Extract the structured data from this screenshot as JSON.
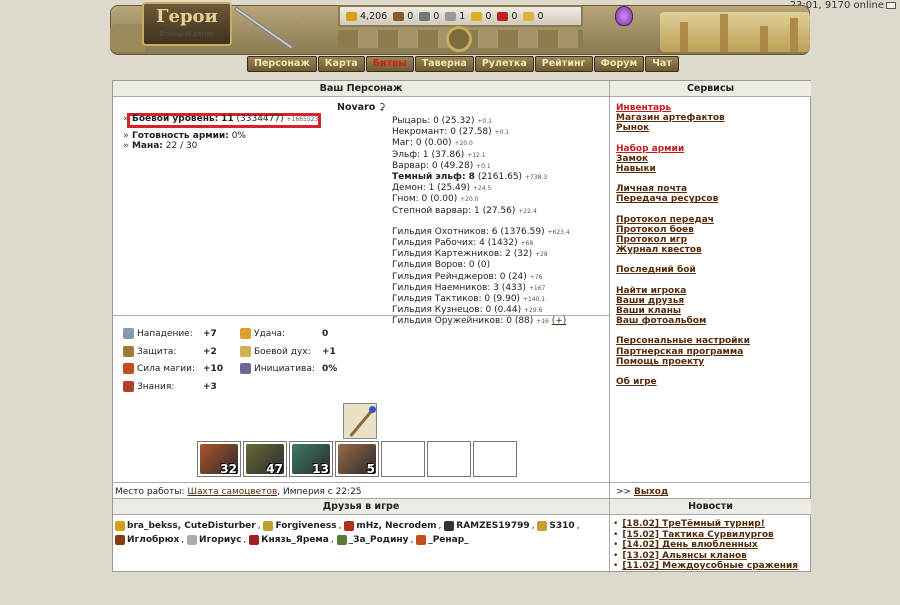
{
  "status": {
    "time_online": "23:01, 9170 online"
  },
  "logo": {
    "title": "Герои",
    "subtitle": "Войны и денег"
  },
  "resources": [
    {
      "icon": "gold-icon",
      "value": "4,206",
      "color": "#d4a017"
    },
    {
      "icon": "wood-icon",
      "value": "0",
      "color": "#8b5a2b"
    },
    {
      "icon": "ore-icon",
      "value": "0",
      "color": "#777777"
    },
    {
      "icon": "mercury-icon",
      "value": "1",
      "color": "#999999"
    },
    {
      "icon": "sulfur-icon",
      "value": "0",
      "color": "#e0b020"
    },
    {
      "icon": "crystal-icon",
      "value": "0",
      "color": "#c02020"
    },
    {
      "icon": "gems-icon",
      "value": "0",
      "color": "#e0b040"
    }
  ],
  "nav": [
    "Персонаж",
    "Карта",
    "Битвы",
    "Таверна",
    "Рулетка",
    "Рейтинг",
    "Форум",
    "Чат"
  ],
  "sections": {
    "character": "Ваш Персонаж",
    "services": "Сервисы",
    "friends": "Друзья в игре",
    "news": "Новости"
  },
  "character": {
    "name": "Novaro",
    "combat_label": "Боевой уровень:",
    "combat_level": "11",
    "combat_exp": "(3334477)",
    "combat_extra": "+1665523",
    "army_label": "Готовность армии:",
    "army_value": "0%",
    "mana_label": "Мана:",
    "mana_value": "22 / 30"
  },
  "factions": [
    {
      "text": "Рыцарь: 0 (25.32)",
      "extra": "+0.1",
      "bold": false
    },
    {
      "text": "Некромант: 0 (27.58)",
      "extra": "+0.1",
      "bold": false
    },
    {
      "text": "Маг: 0 (0.00)",
      "extra": "+20.0",
      "bold": false
    },
    {
      "text": "Эльф: 1 (37.86)",
      "extra": "+12.1",
      "bold": false
    },
    {
      "text": "Варвар: 0 (49.28)",
      "extra": "+0.1",
      "bold": false
    },
    {
      "text": "Темный эльф: 8",
      "text2": " (2161.65)",
      "extra": "+738.3",
      "bold": true
    },
    {
      "text": "Демон: 1 (25.49)",
      "extra": "+24.5",
      "bold": false
    },
    {
      "text": "Гном: 0 (0.00)",
      "extra": "+20.0",
      "bold": false
    },
    {
      "text": "Степной варвар: 1 (27.56)",
      "extra": "+22.4",
      "bold": false
    }
  ],
  "guilds": [
    {
      "text": "Гильдия Охотников: 6 (1376.59)",
      "extra": "+623.4"
    },
    {
      "text": "Гильдия Рабочих: 4 (1432)",
      "extra": "+68"
    },
    {
      "text": "Гильдия Картежников: 2 (32)",
      "extra": "+28"
    },
    {
      "text": "Гильдия Воров: 0 (0)",
      "extra": ""
    },
    {
      "text": "Гильдия Рейнджеров: 0 (24)",
      "extra": "+76"
    },
    {
      "text": "Гильдия Наемников: 3 (433)",
      "extra": "+167"
    },
    {
      "text": "Гильдия Тактиков: 0 (9.90)",
      "extra": "+140.1"
    },
    {
      "text": "Гильдия Кузнецов: 0 (0.44)",
      "extra": "+29.6"
    },
    {
      "text": "Гильдия Оружейников: 0 (88)",
      "extra": "+16",
      "plus": "(+)"
    }
  ],
  "skills": [
    {
      "label": "Нападение:",
      "value": "+7",
      "icon": "swords-icon",
      "color": "#8899aa"
    },
    {
      "label": "Защита:",
      "value": "+2",
      "icon": "shield-icon",
      "color": "#a07a3a"
    },
    {
      "label": "Сила магии:",
      "value": "+10",
      "icon": "wand-icon",
      "color": "#c05020"
    },
    {
      "label": "Знания:",
      "value": "+3",
      "icon": "book-icon",
      "color": "#b04030"
    },
    {
      "label": "Удача:",
      "value": "0",
      "icon": "rainbow-icon",
      "color": "#e0a030"
    },
    {
      "label": "Боевой дух:",
      "value": "+1",
      "icon": "wings-icon",
      "color": "#d0b050"
    },
    {
      "label": "Инициатива:",
      "value": "0%",
      "icon": "hourglass-icon",
      "color": "#6a6a9a"
    }
  ],
  "army": [
    {
      "count": "32",
      "color": "#b0552a"
    },
    {
      "count": "47",
      "color": "#6a6a3a"
    },
    {
      "count": "13",
      "color": "#3e7a6a"
    },
    {
      "count": "5",
      "color": "#9a6a4a"
    }
  ],
  "workplace": {
    "label": "Место работы:",
    "link": "Шахта самоцветов",
    "suffix": ", Империя с 22:25"
  },
  "logout": {
    "prefix": ">>",
    "label": "Выход"
  },
  "services": [
    {
      "label": "Инвентарь",
      "red": true
    },
    {
      "label": "Магазин артефактов"
    },
    {
      "label": "Рынок"
    },
    {
      "gap": true
    },
    {
      "label": "Набор армии",
      "red": true
    },
    {
      "label": "Замок"
    },
    {
      "label": "Навыки"
    },
    {
      "gap": true
    },
    {
      "label": "Личная почта"
    },
    {
      "label": "Передача ресурсов"
    },
    {
      "gap": true
    },
    {
      "label": "Протокол передач"
    },
    {
      "label": "Протокол боев"
    },
    {
      "label": "Протокол игр"
    },
    {
      "label": "Журнал квестов"
    },
    {
      "gap": true
    },
    {
      "label": "Последний бой"
    },
    {
      "gap": true
    },
    {
      "label": "Найти игрока"
    },
    {
      "label": "Ваши друзья"
    },
    {
      "label": "Ваши кланы"
    },
    {
      "label": "Ваш фотоальбом"
    },
    {
      "gap": true
    },
    {
      "label": "Персональные настройки"
    },
    {
      "label": "Партнерская программа"
    },
    {
      "label": "Помощь проекту"
    },
    {
      "gap": true
    },
    {
      "label": "Об игре"
    }
  ],
  "friends": [
    {
      "name": "bra_bekss, CuteDisturber",
      "color": "#d4a017"
    },
    {
      "name": "Forgiveness",
      "color": "#c0a030"
    },
    {
      "name": "mHz, Necrodem",
      "color": "#b03020"
    },
    {
      "name": "RAMZES19799",
      "color": "#333333"
    },
    {
      "name": "S310",
      "color": "#c0a030"
    },
    {
      "name": "Иглобрюх",
      "color": "#8a3a10"
    },
    {
      "name": "Игориус",
      "color": "#aaaaaa"
    },
    {
      "name": "Князь_Ярема",
      "color": "#a02020"
    },
    {
      "name": "_За_Родину",
      "color": "#5a7a3a"
    },
    {
      "name": "_Ренар_",
      "color": "#c05020"
    }
  ],
  "news": [
    "[18.02] ТреТёмный турнир!",
    "[15.02] Тактика Сурвилургов",
    "[14.02] День влюбленных",
    "[13.02] Альянсы кланов",
    "[11.02] Междоусобные сражения"
  ]
}
